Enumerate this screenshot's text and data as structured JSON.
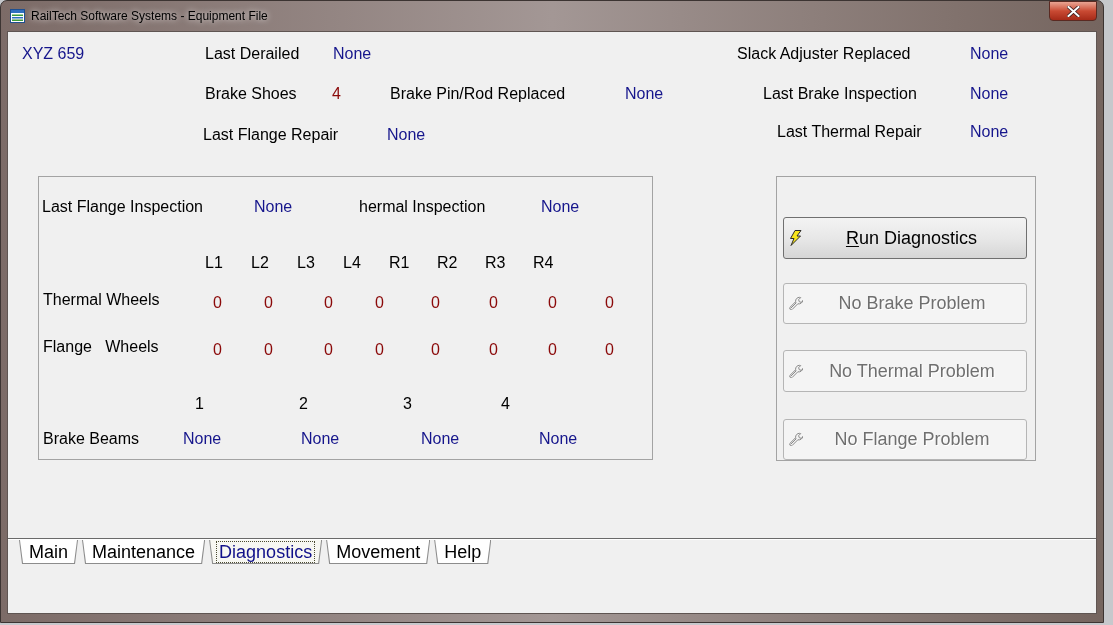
{
  "window": {
    "title": "RailTech Software Systems - Equipment File"
  },
  "equipment_id": "XYZ 659",
  "summary_rows": [
    {
      "fields": [
        {
          "label": "Last Derailed",
          "value": "None",
          "kind": "date"
        },
        {
          "label": "Slack Adjuster Replaced",
          "value": "None",
          "kind": "date"
        }
      ]
    },
    {
      "fields": [
        {
          "label": "Brake Shoes",
          "value": "4",
          "kind": "count"
        },
        {
          "label": "Brake Pin/Rod Replaced",
          "value": "None",
          "kind": "date"
        },
        {
          "label": "Last Brake Inspection",
          "value": "None",
          "kind": "date"
        }
      ]
    },
    {
      "fields": [
        {
          "label": "Last Flange Repair",
          "value": "None",
          "kind": "date"
        },
        {
          "label": "Last Thermal Repair",
          "value": "None",
          "kind": "date"
        }
      ]
    }
  ],
  "inspection_panel": {
    "inspections": [
      {
        "label": "Last Flange Inspection",
        "value": "None"
      },
      {
        "label": "hermal Inspection",
        "value": "None"
      }
    ],
    "wheels": {
      "columns": [
        "L1",
        "L2",
        "L3",
        "L4",
        "R1",
        "R2",
        "R3",
        "R4"
      ],
      "rows": [
        {
          "label": "Thermal Wheels",
          "values": [
            "0",
            "0",
            "0",
            "0",
            "0",
            "0",
            "0",
            "0"
          ]
        },
        {
          "label": "Flange   Wheels",
          "values": [
            "0",
            "0",
            "0",
            "0",
            "0",
            "0",
            "0",
            "0"
          ]
        }
      ]
    },
    "brake_beams": {
      "label": "Brake Beams",
      "columns": [
        "1",
        "2",
        "3",
        "4"
      ],
      "values": [
        "None",
        "None",
        "None",
        "None"
      ]
    }
  },
  "action_panel": {
    "buttons": [
      {
        "label": "Run Diagnostics",
        "kind": "run",
        "disabled": false,
        "access_key_underlined": true
      },
      {
        "label": "No Brake Problem",
        "kind": "clear",
        "disabled": true,
        "access_key_underlined": false
      },
      {
        "label": "No Thermal Problem",
        "kind": "clear",
        "disabled": true,
        "access_key_underlined": false
      },
      {
        "label": "No Flange Problem",
        "kind": "clear",
        "disabled": true,
        "access_key_underlined": false
      }
    ]
  },
  "tabs": [
    {
      "label": "Main",
      "selected": false
    },
    {
      "label": "Maintenance",
      "selected": false
    },
    {
      "label": "Diagnostics",
      "selected": true
    },
    {
      "label": "Movement",
      "selected": false
    },
    {
      "label": "Help",
      "selected": false
    }
  ]
}
